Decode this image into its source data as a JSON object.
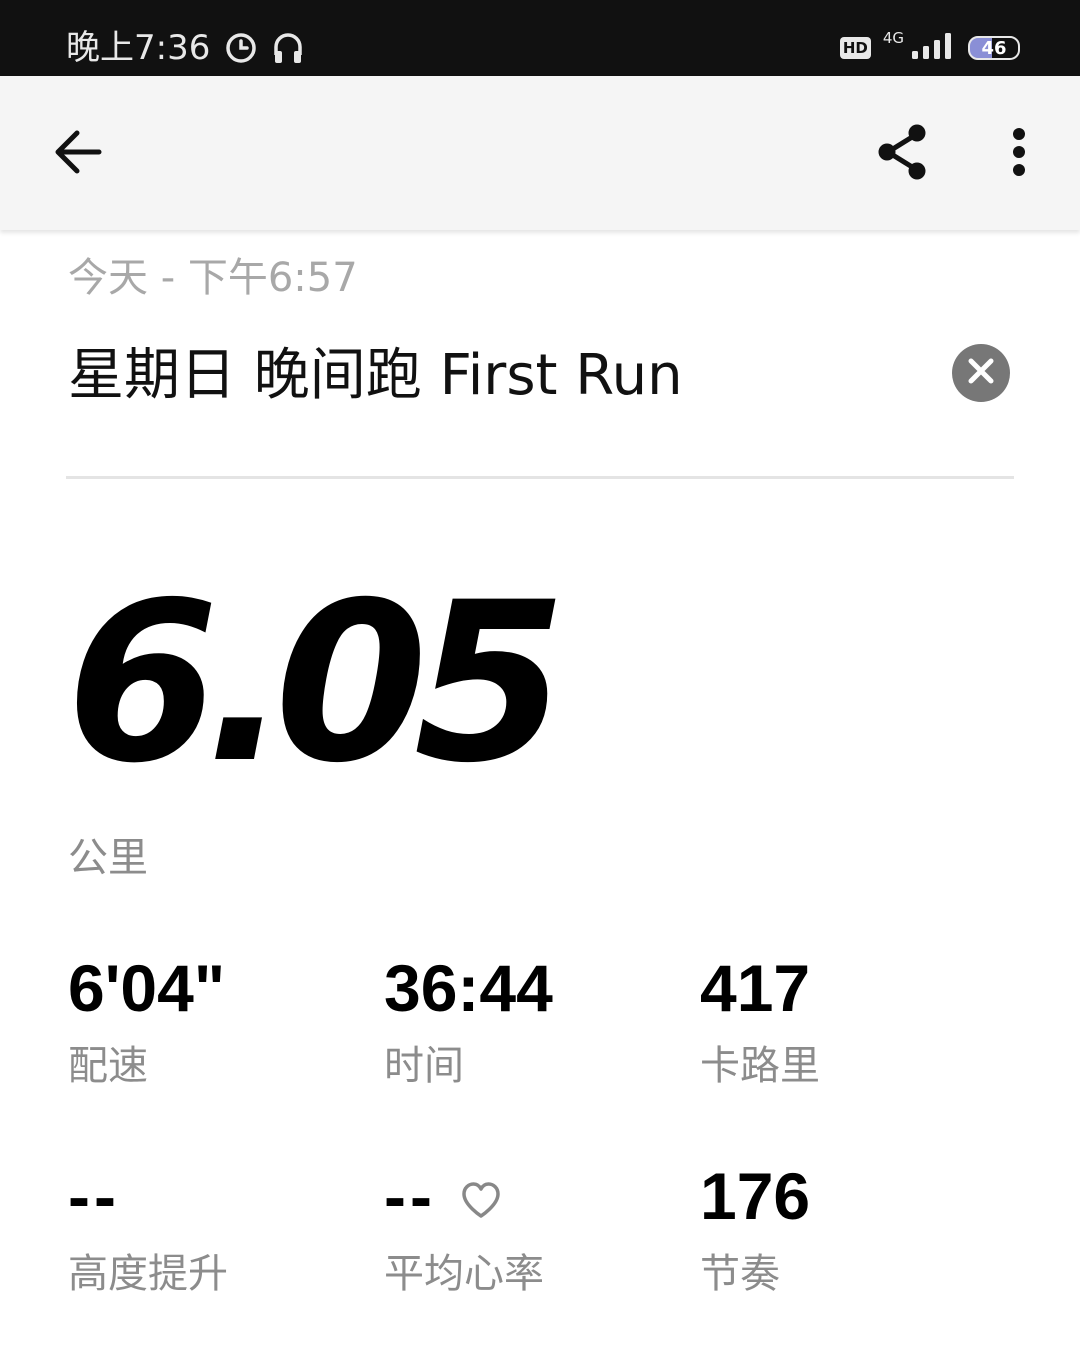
{
  "status_bar": {
    "time": "晚上7:36",
    "hd_label": "HD",
    "network_label": "4G",
    "battery_level": "46",
    "icons": [
      "alarm-icon",
      "headphones-icon",
      "signal-icon",
      "battery-icon"
    ]
  },
  "app_bar": {
    "icons": [
      "back-arrow-icon",
      "share-icon",
      "more-vert-icon"
    ]
  },
  "activity": {
    "date": "今天 - 下午6:57",
    "title": "星期日 晚间跑 First Run",
    "distance": "6.05",
    "distance_unit": "公里"
  },
  "stats": [
    {
      "value": "6'04\"",
      "label": "配速"
    },
    {
      "value": "36:44",
      "label": "时间"
    },
    {
      "value": "417",
      "label": "卡路里"
    },
    {
      "value": "--",
      "label": "高度提升"
    },
    {
      "value": "--",
      "label": "平均心率",
      "icon": "heart-outline-icon"
    },
    {
      "value": "176",
      "label": "节奏"
    }
  ],
  "colors": {
    "status_bar_bg": "#111111",
    "app_bar_bg": "#f5f5f5",
    "secondary_text": "#8c8c8c",
    "battery_accent": "#8a8fd6"
  }
}
